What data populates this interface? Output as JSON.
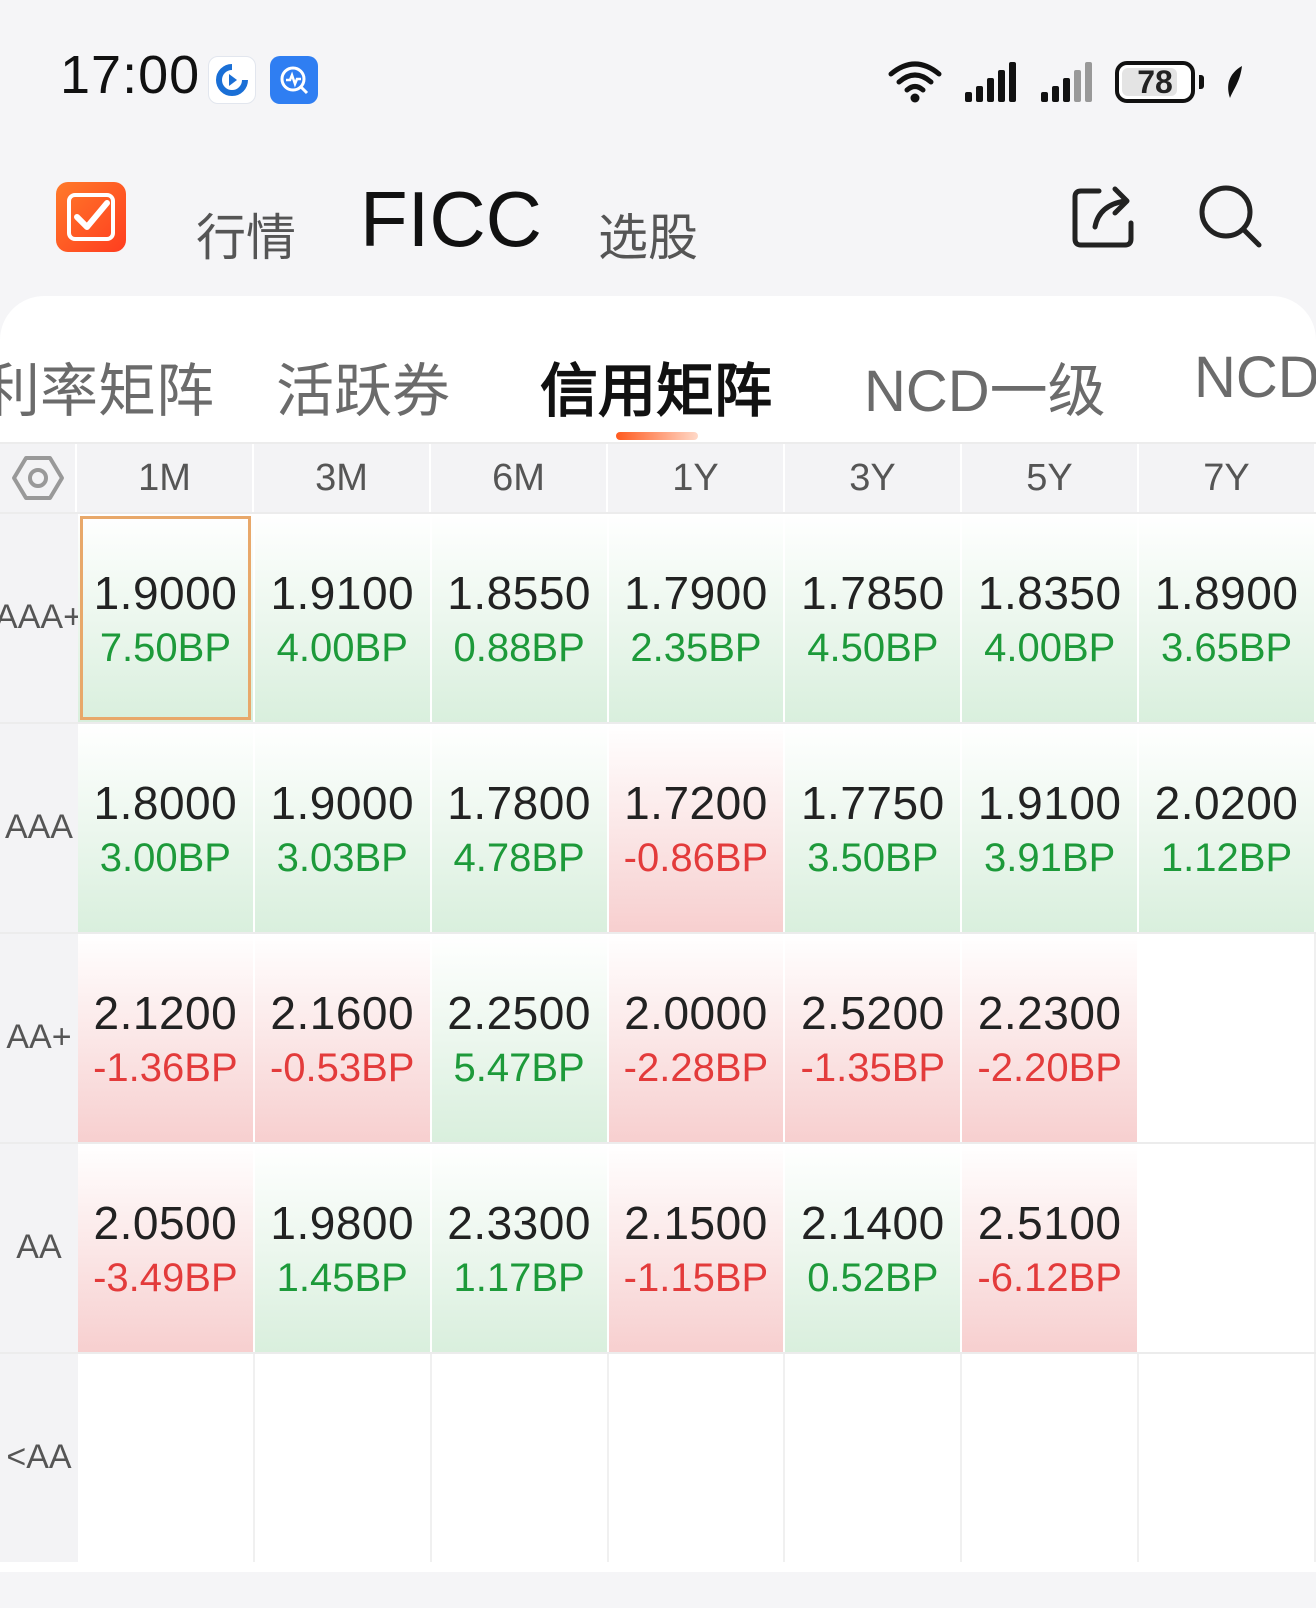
{
  "status": {
    "time": "17:00",
    "battery": "78"
  },
  "header": {
    "nav": [
      "行情",
      "FICC",
      "选股"
    ]
  },
  "tabs": [
    "利率矩阵",
    "活跃券",
    "信用矩阵",
    "NCD一级",
    "NCD"
  ],
  "active_tab": "信用矩阵",
  "matrix": {
    "columns": [
      "1M",
      "3M",
      "6M",
      "1Y",
      "3Y",
      "5Y",
      "7Y"
    ],
    "rows": [
      {
        "label_top": "AAA",
        "label_bottom": "+",
        "cells": [
          {
            "value": "1.9000",
            "bp": "7.50BP",
            "dir": "up"
          },
          {
            "value": "1.9100",
            "bp": "4.00BP",
            "dir": "up"
          },
          {
            "value": "1.8550",
            "bp": "0.88BP",
            "dir": "up"
          },
          {
            "value": "1.7900",
            "bp": "2.35BP",
            "dir": "up"
          },
          {
            "value": "1.7850",
            "bp": "4.50BP",
            "dir": "up"
          },
          {
            "value": "1.8350",
            "bp": "4.00BP",
            "dir": "up"
          },
          {
            "value": "1.8900",
            "bp": "3.65BP",
            "dir": "up"
          }
        ]
      },
      {
        "label_top": "AAA",
        "label_bottom": "",
        "cells": [
          {
            "value": "1.8000",
            "bp": "3.00BP",
            "dir": "up"
          },
          {
            "value": "1.9000",
            "bp": "3.03BP",
            "dir": "up"
          },
          {
            "value": "1.7800",
            "bp": "4.78BP",
            "dir": "up"
          },
          {
            "value": "1.7200",
            "bp": "-0.86BP",
            "dir": "down"
          },
          {
            "value": "1.7750",
            "bp": "3.50BP",
            "dir": "up"
          },
          {
            "value": "1.9100",
            "bp": "3.91BP",
            "dir": "up"
          },
          {
            "value": "2.0200",
            "bp": "1.12BP",
            "dir": "up"
          }
        ]
      },
      {
        "label_top": "AA+",
        "label_bottom": "",
        "cells": [
          {
            "value": "2.1200",
            "bp": "-1.36BP",
            "dir": "down"
          },
          {
            "value": "2.1600",
            "bp": "-0.53BP",
            "dir": "down"
          },
          {
            "value": "2.2500",
            "bp": "5.47BP",
            "dir": "up"
          },
          {
            "value": "2.0000",
            "bp": "-2.28BP",
            "dir": "down"
          },
          {
            "value": "2.5200",
            "bp": "-1.35BP",
            "dir": "down"
          },
          {
            "value": "2.2300",
            "bp": "-2.20BP",
            "dir": "down"
          },
          {
            "value": "",
            "bp": "",
            "dir": "empty"
          }
        ]
      },
      {
        "label_top": "AA",
        "label_bottom": "",
        "cells": [
          {
            "value": "2.0500",
            "bp": "-3.49BP",
            "dir": "down"
          },
          {
            "value": "1.9800",
            "bp": "1.45BP",
            "dir": "up"
          },
          {
            "value": "2.3300",
            "bp": "1.17BP",
            "dir": "up"
          },
          {
            "value": "2.1500",
            "bp": "-1.15BP",
            "dir": "down"
          },
          {
            "value": "2.1400",
            "bp": "0.52BP",
            "dir": "up"
          },
          {
            "value": "2.5100",
            "bp": "-6.12BP",
            "dir": "down"
          },
          {
            "value": "",
            "bp": "",
            "dir": "empty"
          }
        ]
      },
      {
        "label_top": "<AA",
        "label_bottom": "",
        "cells": [
          {
            "value": "",
            "bp": "",
            "dir": "empty"
          },
          {
            "value": "",
            "bp": "",
            "dir": "empty"
          },
          {
            "value": "",
            "bp": "",
            "dir": "empty"
          },
          {
            "value": "",
            "bp": "",
            "dir": "empty"
          },
          {
            "value": "",
            "bp": "",
            "dir": "empty"
          },
          {
            "value": "",
            "bp": "",
            "dir": "empty"
          },
          {
            "value": "",
            "bp": "",
            "dir": "empty"
          }
        ]
      }
    ]
  },
  "colors": {
    "up_text": "#1d9a3a",
    "down_text": "#e33b3b",
    "up_bg": "#d9efdd",
    "down_bg": "#f7cfcf",
    "accent": "#ff5a1f",
    "selected_border": "#e8a86a"
  },
  "icons": [
    "app-notification-icon",
    "app-chart-icon",
    "wifi-icon",
    "signal-icon",
    "battery-icon",
    "leaf-icon",
    "app-logo-check-icon",
    "share-icon",
    "search-icon",
    "settings-hexagon-icon"
  ]
}
